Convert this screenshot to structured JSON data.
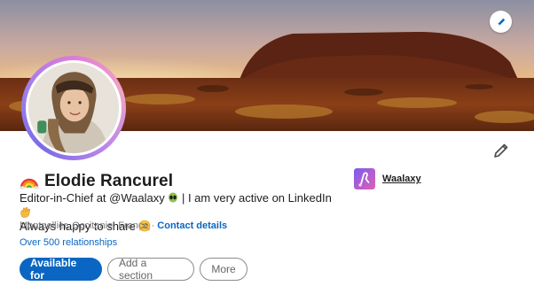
{
  "profile": {
    "name": "Elodie Rancurel",
    "headline_line1": "Editor-in-Chief at @Waalaxy",
    "headline_line1b": " | I am very active on LinkedIn ",
    "headline_line2": "Always happy to share ",
    "location": "Montpellier, Occitanie, France · ",
    "contact_details": "Contact details",
    "relationships_count": "Over 500",
    "relationships_label": " relationships"
  },
  "company": {
    "name": "Waalaxy"
  },
  "actions": {
    "available_for": "Available for",
    "add_section": "Add a section",
    "more": "More"
  },
  "colors": {
    "accent": "#0a66c2",
    "avatar_ring_start": "#e07bd6",
    "avatar_ring_end": "#7b6be6",
    "text": "#1d1d1d",
    "muted": "#7a7a7a"
  },
  "icons": {
    "cover_edit": "pencil-icon",
    "profile_edit": "pencil-icon",
    "name_emoji": "rainbow-icon",
    "headline_emoji_1": "alien-icon",
    "headline_emoji_2": "waving-hand-icon",
    "headline_emoji_3": "hugging-face-icon"
  }
}
